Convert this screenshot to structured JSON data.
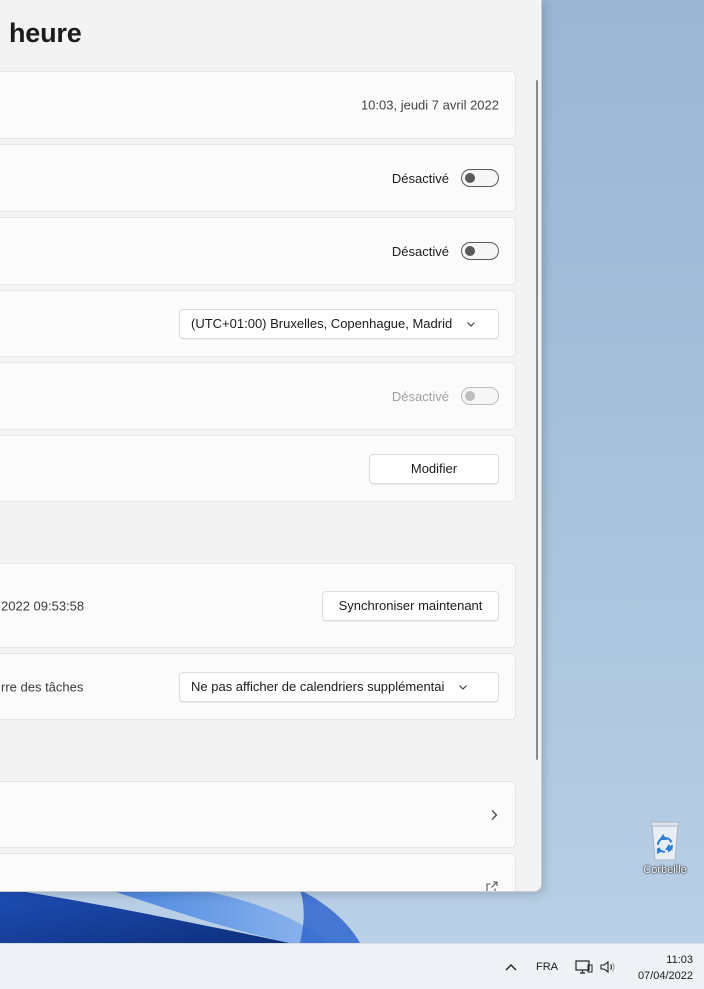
{
  "page": {
    "title": "heure"
  },
  "rows": {
    "current_datetime": "10:03, jeudi 7 avril 2022",
    "auto_time": {
      "state_label": "Désactivé"
    },
    "auto_timezone": {
      "state_label": "Désactivé"
    },
    "timezone": {
      "selected": "(UTC+01:00) Bruxelles, Copenhague, Madrid"
    },
    "dst": {
      "state_label": "Désactivé"
    },
    "manual_datetime": {
      "button_label": "Modifier"
    },
    "sync": {
      "last_sync_text": "2022 09:53:58",
      "button_label": "Synchroniser maintenant"
    },
    "extra_calendars": {
      "label": "rre des tâches",
      "selected": "Ne pas afficher de calendriers supplémentai"
    }
  },
  "desktop": {
    "recycle_bin_label": "Corbeille"
  },
  "taskbar": {
    "language": "FRA",
    "time": "11:03",
    "date": "07/04/2022"
  },
  "colors": {
    "wallpaper": "#9bb8d6",
    "window_bg": "#f3f3f3",
    "card_bg": "#fbfbfb",
    "accent_blue": "#1a63c6"
  }
}
